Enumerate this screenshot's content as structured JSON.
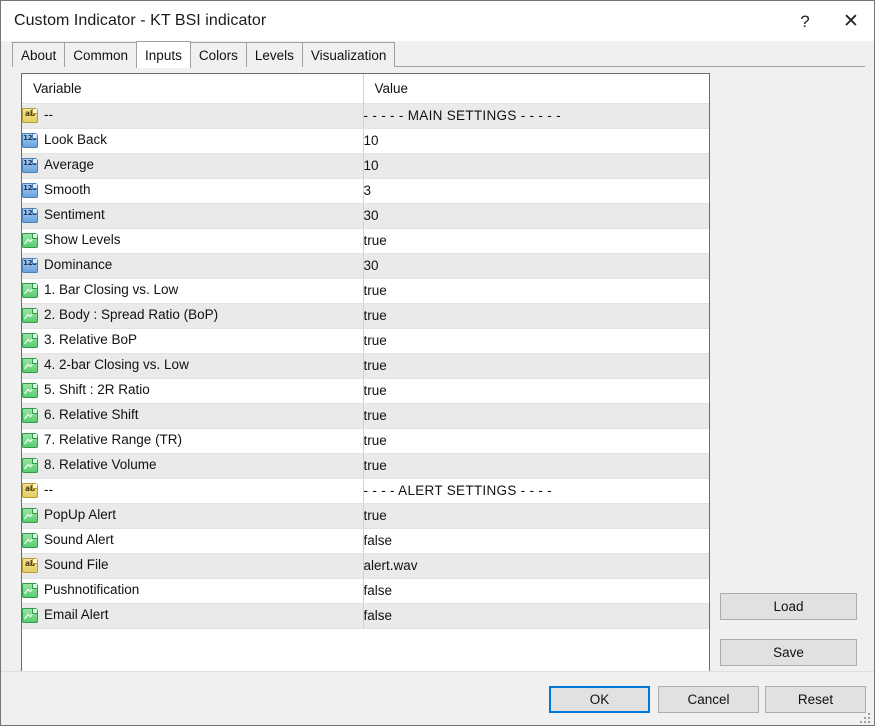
{
  "window": {
    "title": "Custom Indicator - KT BSI indicator",
    "help_glyph": "?",
    "close_glyph": "✕"
  },
  "tabs": [
    {
      "label": "About",
      "selected": false
    },
    {
      "label": "Common",
      "selected": false
    },
    {
      "label": "Inputs",
      "selected": true
    },
    {
      "label": "Colors",
      "selected": false
    },
    {
      "label": "Levels",
      "selected": false
    },
    {
      "label": "Visualization",
      "selected": false
    }
  ],
  "table": {
    "headers": {
      "variable": "Variable",
      "value": "Value"
    },
    "rows": [
      {
        "icon": "string-type-icon",
        "name": "--",
        "value": "- - - - - MAIN SETTINGS - - - - -"
      },
      {
        "icon": "integer-type-icon",
        "name": "Look Back",
        "value": "10"
      },
      {
        "icon": "integer-type-icon",
        "name": "Average",
        "value": "10"
      },
      {
        "icon": "integer-type-icon",
        "name": "Smooth",
        "value": "3"
      },
      {
        "icon": "integer-type-icon",
        "name": "Sentiment",
        "value": "30"
      },
      {
        "icon": "boolean-type-icon",
        "name": "Show Levels",
        "value": "true"
      },
      {
        "icon": "integer-type-icon",
        "name": "Dominance",
        "value": "30"
      },
      {
        "icon": "boolean-type-icon",
        "name": "1. Bar Closing vs. Low",
        "value": "true"
      },
      {
        "icon": "boolean-type-icon",
        "name": "2. Body : Spread Ratio (BoP)",
        "value": "true"
      },
      {
        "icon": "boolean-type-icon",
        "name": "3. Relative BoP",
        "value": "true"
      },
      {
        "icon": "boolean-type-icon",
        "name": "4. 2-bar Closing vs. Low",
        "value": "true"
      },
      {
        "icon": "boolean-type-icon",
        "name": "5. Shift : 2R Ratio",
        "value": "true"
      },
      {
        "icon": "boolean-type-icon",
        "name": "6. Relative Shift",
        "value": "true"
      },
      {
        "icon": "boolean-type-icon",
        "name": "7. Relative Range (TR)",
        "value": "true"
      },
      {
        "icon": "boolean-type-icon",
        "name": "8. Relative Volume",
        "value": "true"
      },
      {
        "icon": "string-type-icon",
        "name": "--",
        "value": "- - - - ALERT SETTINGS - - - -"
      },
      {
        "icon": "boolean-type-icon",
        "name": "PopUp Alert",
        "value": "true"
      },
      {
        "icon": "boolean-type-icon",
        "name": "Sound Alert",
        "value": "false"
      },
      {
        "icon": "string-type-icon",
        "name": "Sound File",
        "value": "alert.wav"
      },
      {
        "icon": "boolean-type-icon",
        "name": "Pushnotification",
        "value": "false"
      },
      {
        "icon": "boolean-type-icon",
        "name": "Email Alert",
        "value": "false"
      }
    ]
  },
  "side_buttons": {
    "load": "Load",
    "save": "Save"
  },
  "footer_buttons": {
    "ok": "OK",
    "cancel": "Cancel",
    "reset": "Reset"
  },
  "colors": {
    "focus_border": "#0078d7",
    "row_stripe": "#eaeaea",
    "integer_icon": "#6ba3dd",
    "string_icon": "#e4cd63",
    "boolean_icon": "#59cc73"
  }
}
